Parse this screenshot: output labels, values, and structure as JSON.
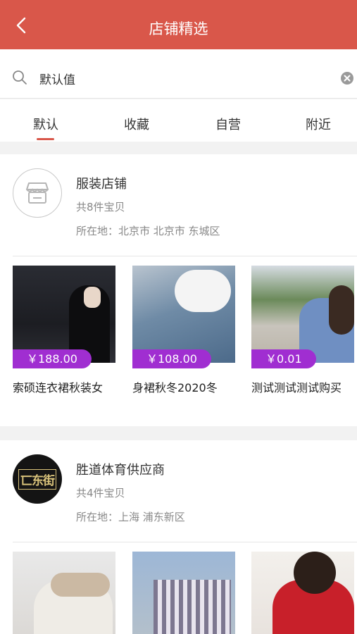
{
  "header": {
    "title": "店铺精选"
  },
  "search": {
    "value": "默认值"
  },
  "tabs": [
    {
      "label": "默认"
    },
    {
      "label": "收藏"
    },
    {
      "label": "自营"
    },
    {
      "label": "附近"
    }
  ],
  "shops": [
    {
      "name": "服装店铺",
      "count": "共8件宝贝",
      "location": "所在地：北京市 北京市 东城区",
      "products": [
        {
          "price": "￥188.00",
          "name": "索硕连衣裙秋装女"
        },
        {
          "price": "￥108.00",
          "name": "身裙秋冬2020冬"
        },
        {
          "price": "￥0.01",
          "name": "测试测试测试购买"
        }
      ]
    },
    {
      "name": "胜道体育供应商",
      "logo_text": "匸东街",
      "count": "共4件宝贝",
      "location": "所在地：上海 浦东新区"
    }
  ],
  "colors": {
    "brand": "#d9574a",
    "price_tag": "#a02ed1"
  },
  "icons": {
    "back": "chevron-left-icon",
    "search": "search-icon",
    "clear": "clear-icon",
    "store": "store-icon"
  }
}
